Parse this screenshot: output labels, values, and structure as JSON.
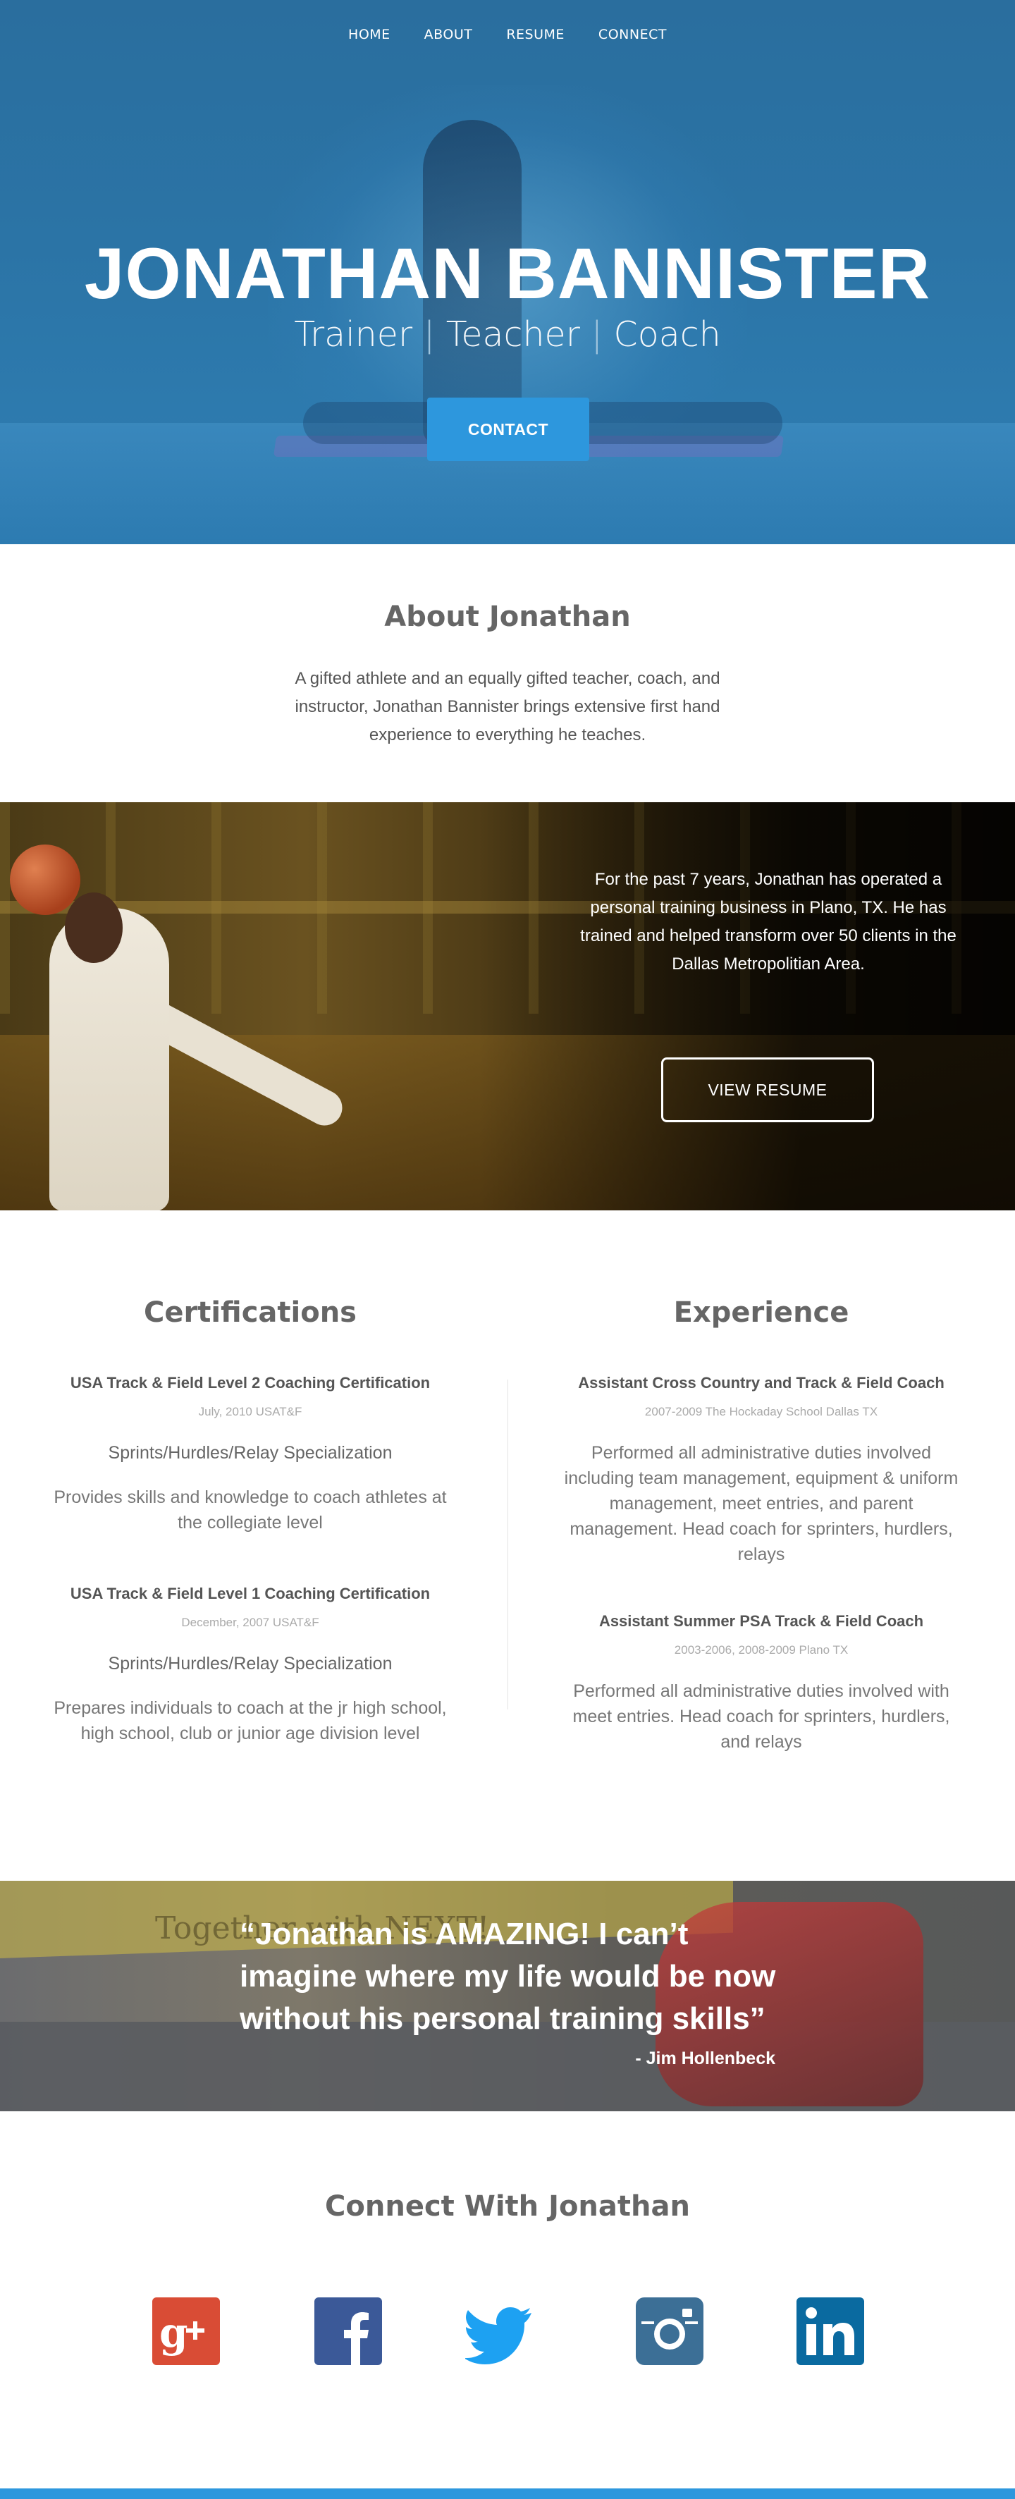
{
  "nav": {
    "items": [
      "HOME",
      "ABOUT",
      "RESUME",
      "CONNECT"
    ]
  },
  "hero": {
    "name": "JONATHAN BANNISTER",
    "roles": [
      "Trainer",
      "Teacher",
      "Coach"
    ],
    "separator": "|",
    "contact_label": "CONTACT"
  },
  "about": {
    "title": "About Jonathan",
    "text": "A gifted athlete and an equally gifted teacher, coach, and instructor, Jonathan Bannister brings extensive first hand experience to everything he teaches."
  },
  "banner": {
    "text": "For the past 7 years, Jonathan has operated a personal training business in Plano, TX. He has trained and helped transform over 50 clients in the Dallas Metropolitian Area.",
    "resume_label": "VIEW RESUME"
  },
  "certifications": {
    "title": "Certifications",
    "entries": [
      {
        "title": "USA Track & Field Level 2 Coaching Certification",
        "meta": "July, 2010 USAT&F",
        "spec": "Sprints/Hurdles/Relay Specialization",
        "desc": "Provides skills and knowledge to coach athletes at the collegiate level"
      },
      {
        "title": "USA Track & Field Level 1 Coaching Certification",
        "meta": "December, 2007 USAT&F",
        "spec": "Sprints/Hurdles/Relay Specialization",
        "desc": "Prepares individuals to coach at the jr high school, high school, club or junior age division level"
      }
    ]
  },
  "experience": {
    "title": "Experience",
    "entries": [
      {
        "title": "Assistant Cross Country and Track & Field Coach",
        "meta": "2007-2009 The Hockaday School Dallas TX",
        "desc": "Performed all administrative duties involved including team management, equipment & uniform management, meet entries, and parent management. Head coach for sprinters, hurdlers, relays"
      },
      {
        "title": "Assistant Summer PSA Track & Field Coach",
        "meta": "2003-2006, 2008-2009  Plano TX",
        "desc": "Performed all administrative duties involved with meet entries. Head coach for sprinters, hurdlers, and relays"
      }
    ]
  },
  "quote": {
    "watermark": "Together with NEXT!",
    "text": "“Jonathan is AMAZING! I can’t imagine where my life would be now without his personal training skills”",
    "author": "- Jim Hollenbeck"
  },
  "connect": {
    "title": "Connect With Jonathan",
    "icons": [
      "google-plus-icon",
      "facebook-icon",
      "twitter-icon",
      "instagram-icon",
      "linkedin-icon"
    ]
  },
  "colors": {
    "hero_blue": "#2b74a6",
    "accent": "#2d97dd",
    "google_plus": "#d94c35",
    "facebook": "#3b5998",
    "twitter": "#1da1f2",
    "instagram": "#3c6f96",
    "linkedin": "#0a6aa0"
  }
}
